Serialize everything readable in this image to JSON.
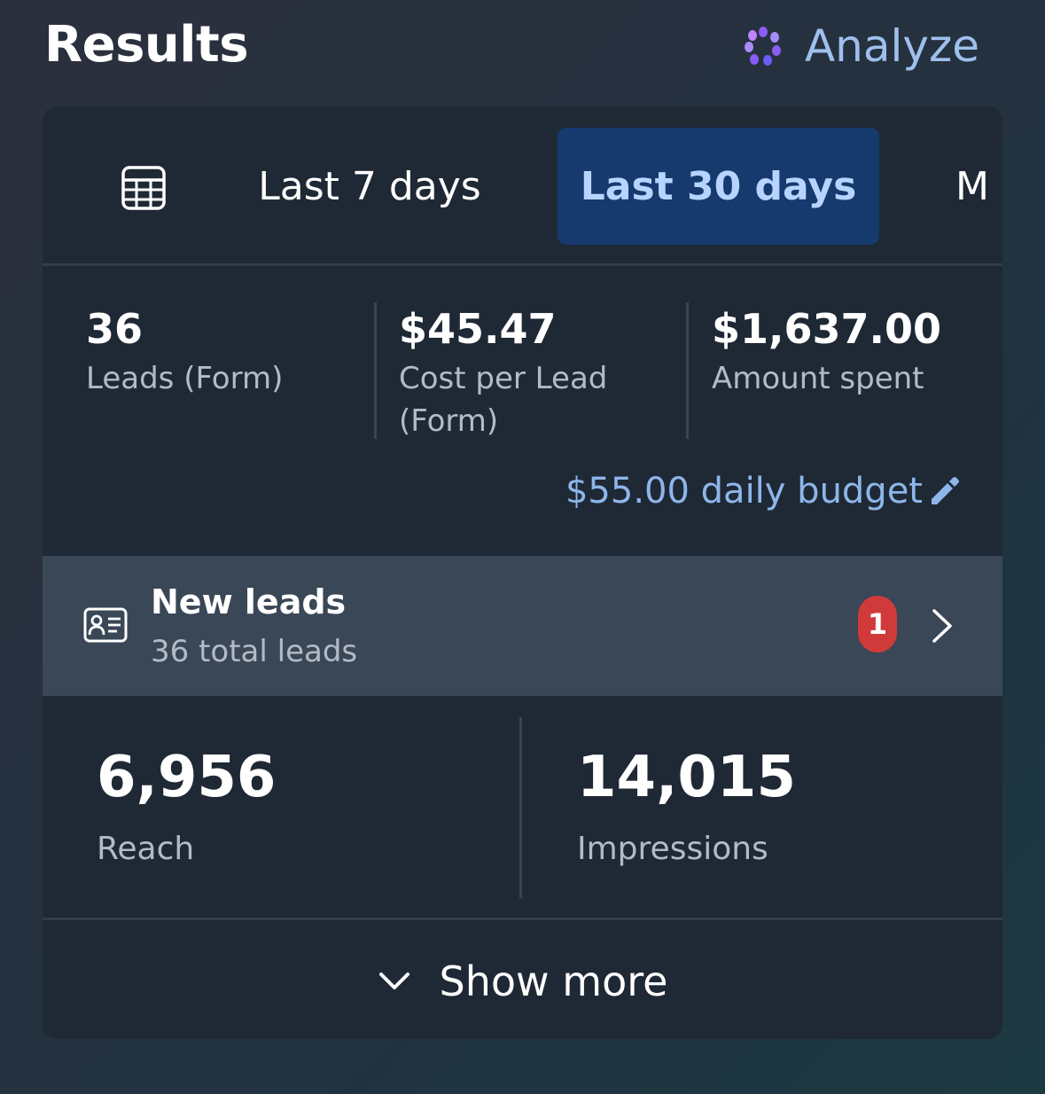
{
  "header": {
    "title": "Results",
    "analyze_label": "Analyze"
  },
  "tabs": {
    "items": [
      {
        "label": "Last 7 days",
        "selected": false
      },
      {
        "label": "Last 30 days",
        "selected": true
      },
      {
        "label": "M",
        "selected": false
      }
    ]
  },
  "stats": [
    {
      "value": "36",
      "label": "Leads (Form)"
    },
    {
      "value": "$45.47",
      "label": "Cost per Lead (Form)"
    },
    {
      "value": "$1,637.00",
      "label": "Amount spent"
    }
  ],
  "budget": {
    "label": "$55.00 daily budget"
  },
  "leads": {
    "title": "New leads",
    "subtitle": "36 total leads",
    "badge": "1"
  },
  "metrics": [
    {
      "value": "6,956",
      "label": "Reach"
    },
    {
      "value": "14,015",
      "label": "Impressions"
    }
  ],
  "show_more": {
    "label": "Show more"
  },
  "colors": {
    "accent_selected_tab": "#163a6e",
    "link_blue": "#8db6ea",
    "badge_red": "#d13a3a",
    "sparkle_purple": "#8b5cf6"
  }
}
